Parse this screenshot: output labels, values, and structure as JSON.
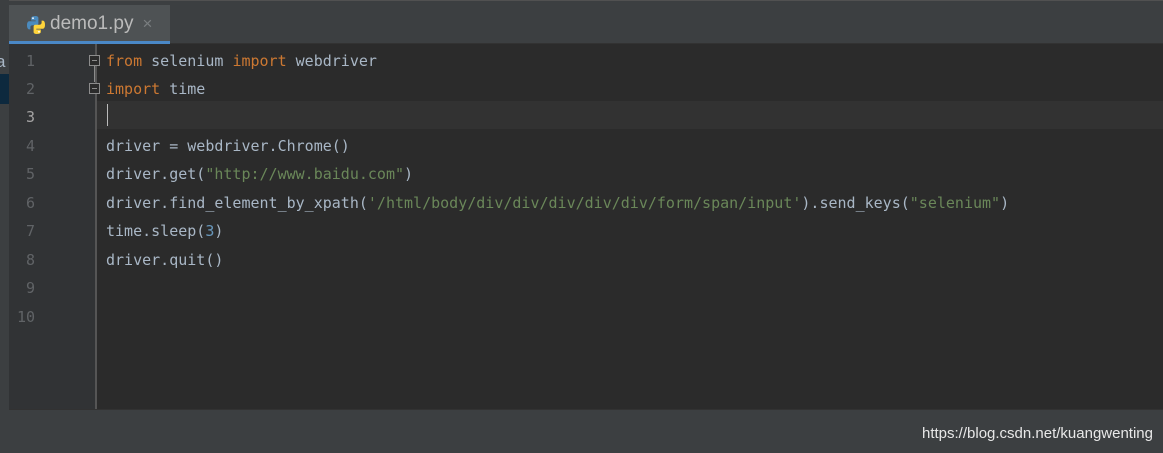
{
  "project_panel": {
    "cut_text": "a"
  },
  "tabs": [
    {
      "label": "demo1.py",
      "icon": "python-file-icon",
      "close_label": "×",
      "active": true
    }
  ],
  "editor": {
    "line_numbers": [
      "1",
      "2",
      "3",
      "4",
      "5",
      "6",
      "7",
      "8",
      "9",
      "10"
    ],
    "current_line": 3,
    "lines": [
      [
        {
          "t": "from",
          "c": "kw"
        },
        {
          "t": " selenium ",
          "c": ""
        },
        {
          "t": "import",
          "c": "kw"
        },
        {
          "t": " webdriver",
          "c": ""
        }
      ],
      [
        {
          "t": "import",
          "c": "kw"
        },
        {
          "t": " time",
          "c": ""
        }
      ],
      [],
      [
        {
          "t": "driver = webdriver.Chrome()",
          "c": ""
        }
      ],
      [
        {
          "t": "driver.get(",
          "c": ""
        },
        {
          "t": "\"http://www.baidu.com\"",
          "c": "str"
        },
        {
          "t": ")",
          "c": ""
        }
      ],
      [
        {
          "t": "driver.find_element_by_xpath(",
          "c": ""
        },
        {
          "t": "'/html/body/div/div/div/div/div/form/span/input'",
          "c": "str"
        },
        {
          "t": ").send_keys(",
          "c": ""
        },
        {
          "t": "\"selenium\"",
          "c": "str"
        },
        {
          "t": ")",
          "c": ""
        }
      ],
      [
        {
          "t": "time.sleep(",
          "c": ""
        },
        {
          "t": "3",
          "c": "num"
        },
        {
          "t": ")",
          "c": ""
        }
      ],
      [
        {
          "t": "driver.quit()",
          "c": ""
        }
      ],
      [],
      []
    ]
  },
  "watermark": "https://blog.csdn.net/kuangwenting",
  "colors": {
    "background": "#2b2b2b",
    "keyword": "#cc7832",
    "string": "#6a8759",
    "number": "#6897bb",
    "text": "#a9b7c6",
    "tab_underline": "#4a88c7"
  }
}
